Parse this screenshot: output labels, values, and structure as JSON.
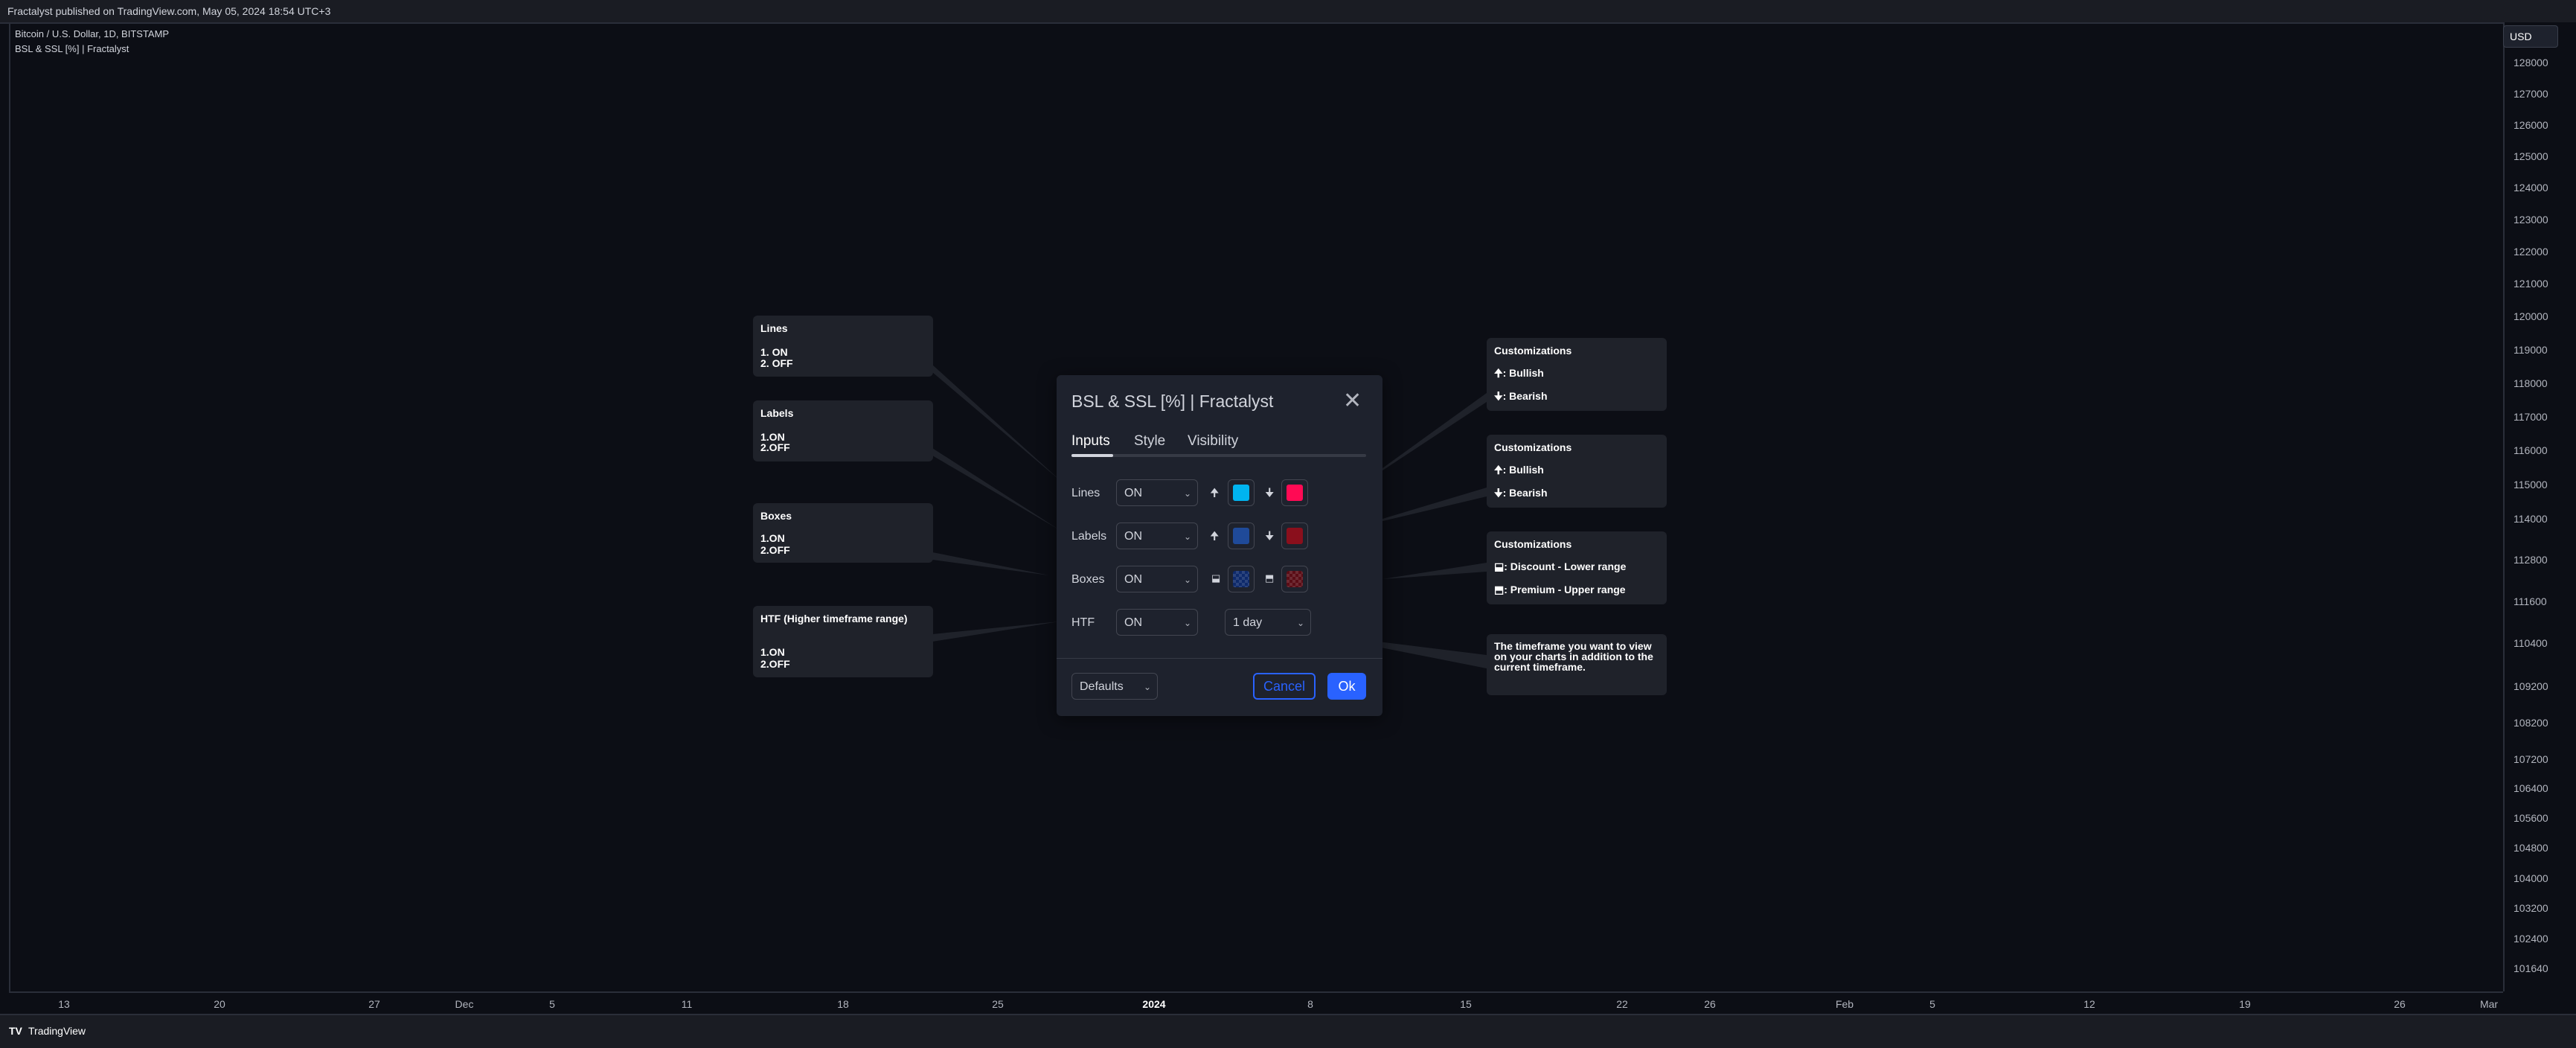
{
  "topbar": {
    "text": "Fractalyst published on TradingView.com, May 05, 2024 18:54 UTC+3"
  },
  "legend": {
    "symbol": "Bitcoin / U.S. Dollar, 1D, BITSTAMP",
    "indicator": "BSL & SSL [%] | Fractalyst"
  },
  "price_axis": {
    "currency": "USD",
    "labels": [
      "128000",
      "127000",
      "126000",
      "125000",
      "124000",
      "123000",
      "122000",
      "121000",
      "120000",
      "119000",
      "118000",
      "117000",
      "116000",
      "115000",
      "114000",
      "112800",
      "111600",
      "110400",
      "109200",
      "108200",
      "107200",
      "106400",
      "105600",
      "104800",
      "104000",
      "103200",
      "102400",
      "101640"
    ]
  },
  "time_axis": {
    "labels": [
      "13",
      "20",
      "27",
      "Dec",
      "5",
      "11",
      "18",
      "25",
      "2024",
      "8",
      "15",
      "22",
      "26",
      "Feb",
      "5",
      "12",
      "19",
      "26",
      "Mar"
    ]
  },
  "footer": {
    "logo": "TV",
    "text": "TradingView"
  },
  "dialog": {
    "title": "BSL & SSL [%] | Fractalyst",
    "tabs": [
      "Inputs",
      "Style",
      "Visibility"
    ],
    "active_tab": "Inputs",
    "rows": [
      {
        "label": "Lines",
        "value": "ON",
        "icon_up": "🠉",
        "icon_down": "🠋",
        "color_up": "#00b4f0",
        "color_down": "#ff0a54"
      },
      {
        "label": "Labels",
        "value": "ON",
        "icon_up": "🠉",
        "icon_down": "🠋",
        "color_up": "#1f4a99",
        "color_down": "#8a0f1c"
      },
      {
        "label": "Boxes",
        "value": "ON",
        "icon_up": "⬓",
        "icon_down": "⬒",
        "color_up": "#0e2a6b",
        "color_down": "#5a0d16"
      },
      {
        "label": "HTF",
        "value": "ON",
        "timeframe": "1 day"
      }
    ],
    "defaults_label": "Defaults",
    "cancel_label": "Cancel",
    "ok_label": "Ok",
    "close_icon": "close-icon"
  },
  "callouts_left": [
    {
      "title": "Lines",
      "lines": [
        "1. ON",
        "2. OFF"
      ]
    },
    {
      "title": "Labels",
      "lines": [
        "1.ON",
        "2.OFF"
      ]
    },
    {
      "title": "Boxes",
      "lines": [
        "1.ON",
        "2.OFF"
      ]
    },
    {
      "title": "HTF (Higher timeframe range)",
      "lines": [
        "1.ON",
        "2.OFF"
      ]
    }
  ],
  "callouts_right": [
    {
      "title": "Customizations",
      "lines": [
        "🠉: Bullish",
        "🠋: Bearish"
      ]
    },
    {
      "title": "Customizations",
      "lines": [
        "🠉: Bullish",
        "🠋: Bearish"
      ]
    },
    {
      "title": "Customizations",
      "lines": [
        "⬓: Discount - Lower range",
        "⬒: Premium - Upper range"
      ]
    },
    {
      "title": "The timeframe you want to view on your charts in addition to the current timeframe.",
      "lines": []
    }
  ],
  "colors": {
    "background": "#0c0e15",
    "accent": "#2962ff",
    "panel": "#1e222d"
  }
}
